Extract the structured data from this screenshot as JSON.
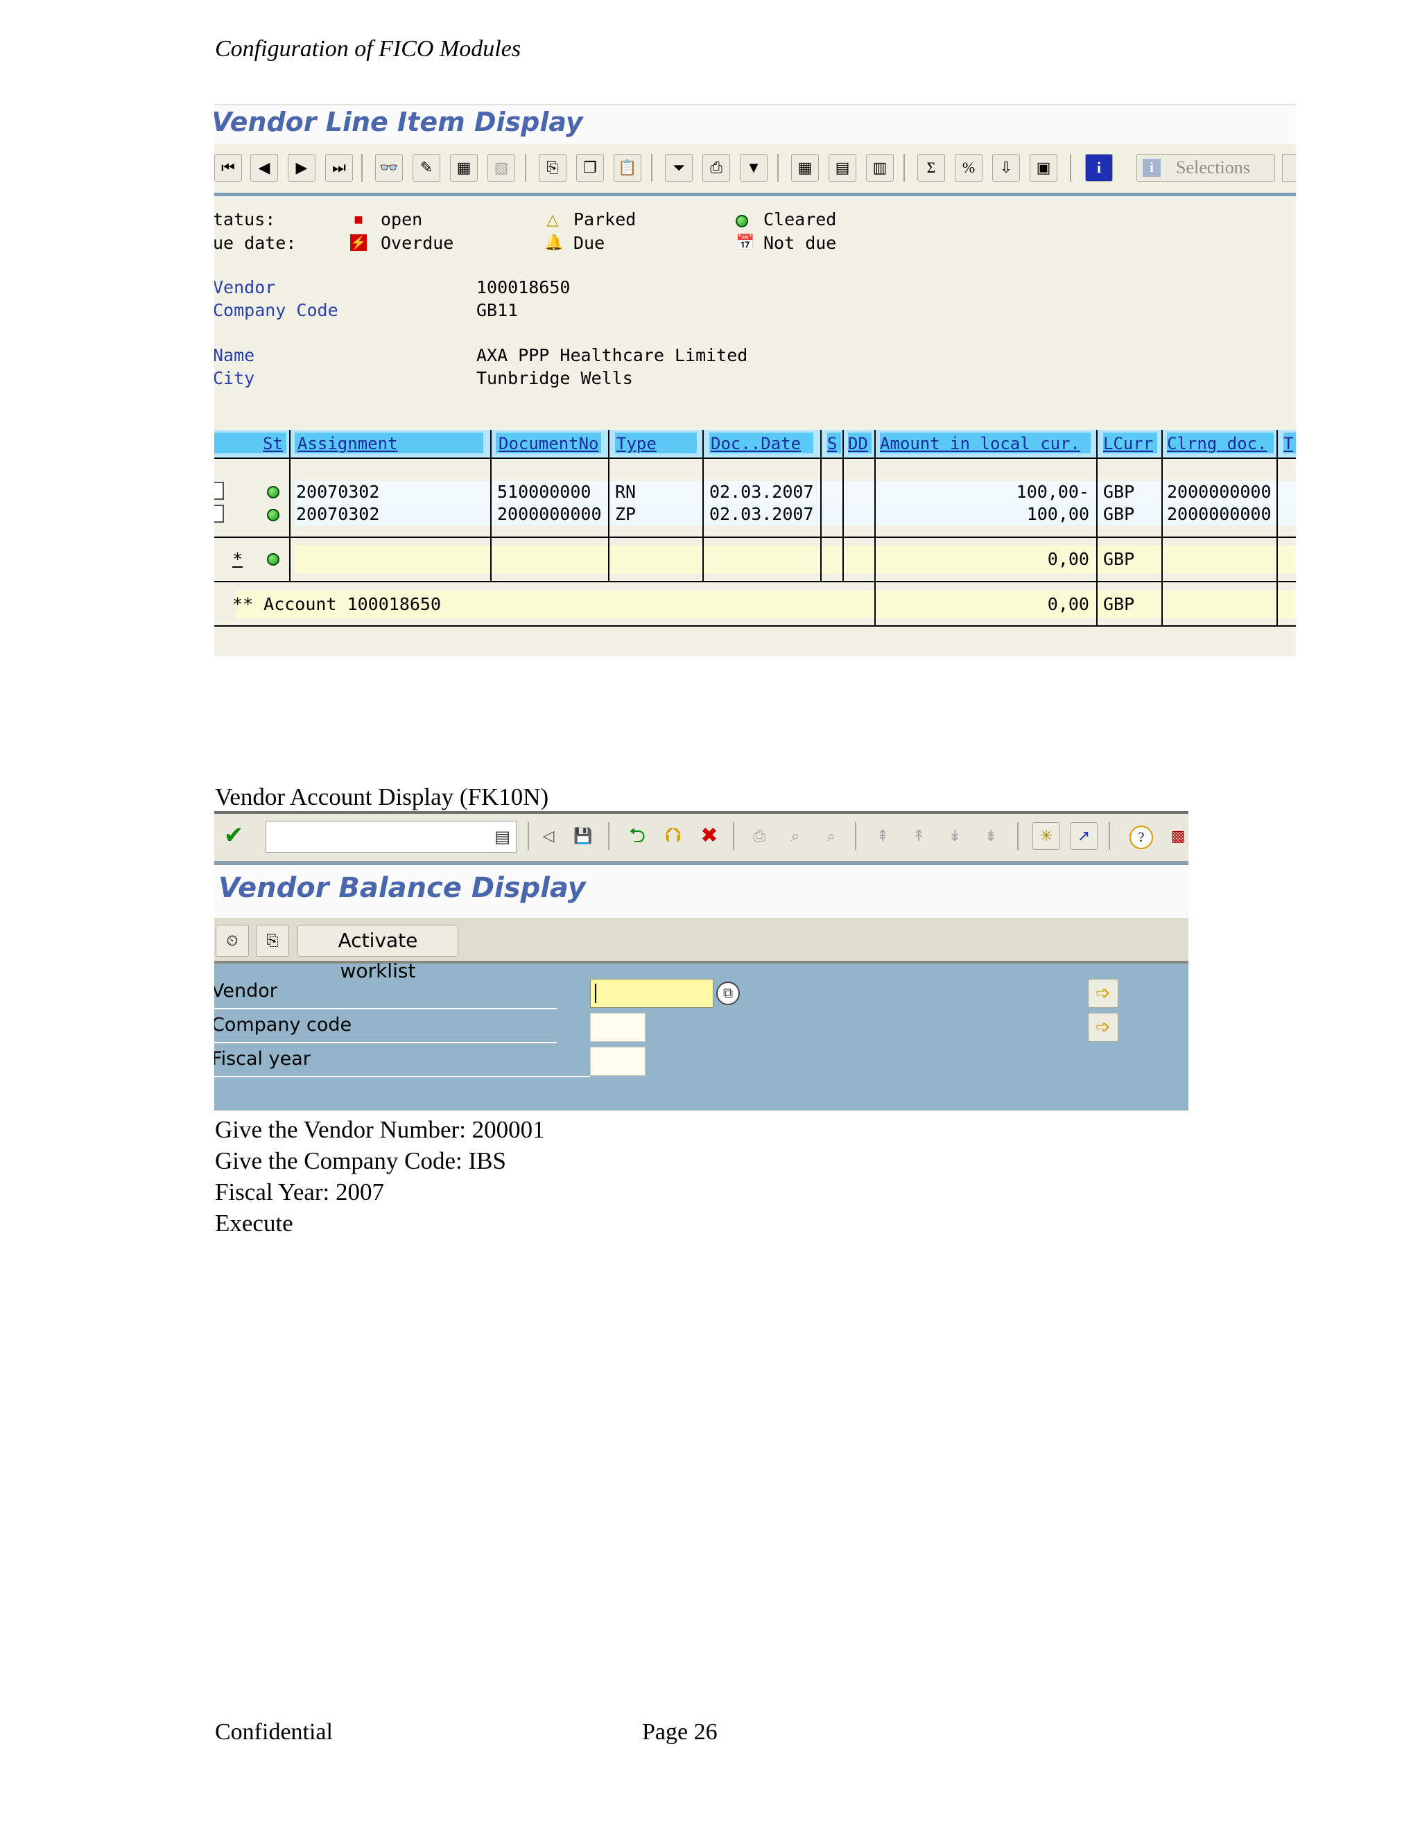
{
  "header": {
    "text": "Configuration of FICO Modules"
  },
  "screenshot1": {
    "title": "Vendor Line Item Display",
    "toolbar": {
      "selections_label": "Selections"
    },
    "legend": {
      "status_label": "tatus:",
      "due_label": "ue date:",
      "open": "open",
      "overdue": "Overdue",
      "parked": "Parked",
      "due": "Due",
      "cleared": "Cleared",
      "not_due": "Not due"
    },
    "fields": [
      {
        "label": "Vendor",
        "value": "100018650"
      },
      {
        "label": "Company Code",
        "value": "GB11"
      },
      {
        "label": "Name",
        "value": "AXA PPP Healthcare Limited"
      },
      {
        "label": "City",
        "value": "Tunbridge Wells"
      }
    ],
    "columns": [
      "St",
      "Assignment",
      "DocumentNo",
      "Type",
      "Doc..Date",
      "S",
      "DD",
      "Amount in local cur.",
      "LCurr",
      "Clrng doc.",
      "T"
    ],
    "rows": [
      {
        "assignment": "20070302",
        "document_no": "510000000",
        "type": "RN",
        "doc_date": "02.03.2007",
        "amount": "100,00-",
        "lcurr": "GBP",
        "clrng_doc": "2000000000"
      },
      {
        "assignment": "20070302",
        "document_no": "2000000000",
        "type": "ZP",
        "doc_date": "02.03.2007",
        "amount": "100,00",
        "lcurr": "GBP",
        "clrng_doc": "2000000000"
      }
    ],
    "subtotal": {
      "marker": "*",
      "amount": "0,00",
      "lcurr": "GBP"
    },
    "total": {
      "label": "** Account 100018650",
      "amount": "0,00",
      "lcurr": "GBP"
    }
  },
  "caption2": "Vendor Account Display (FK10N)",
  "screenshot2": {
    "title": "Vendor Balance Display",
    "activate_worklist": "Activate worklist",
    "fields": [
      {
        "label": "Vendor"
      },
      {
        "label": "Company code"
      },
      {
        "label": "Fiscal year"
      }
    ]
  },
  "instructions": [
    "Give the Vendor Number: 200001",
    "Give the Company Code: IBS",
    "Fiscal Year: 2007",
    "Execute"
  ],
  "footer": {
    "left": "Confidential",
    "page": "Page 26"
  },
  "colors": {
    "sap_title": "#4a66ac",
    "grid_header": "#b5e6fb",
    "grid_header_cell": "#5cc8f6",
    "sum_row": "#fbfbd5",
    "selection_screen": "#94b5c9"
  }
}
